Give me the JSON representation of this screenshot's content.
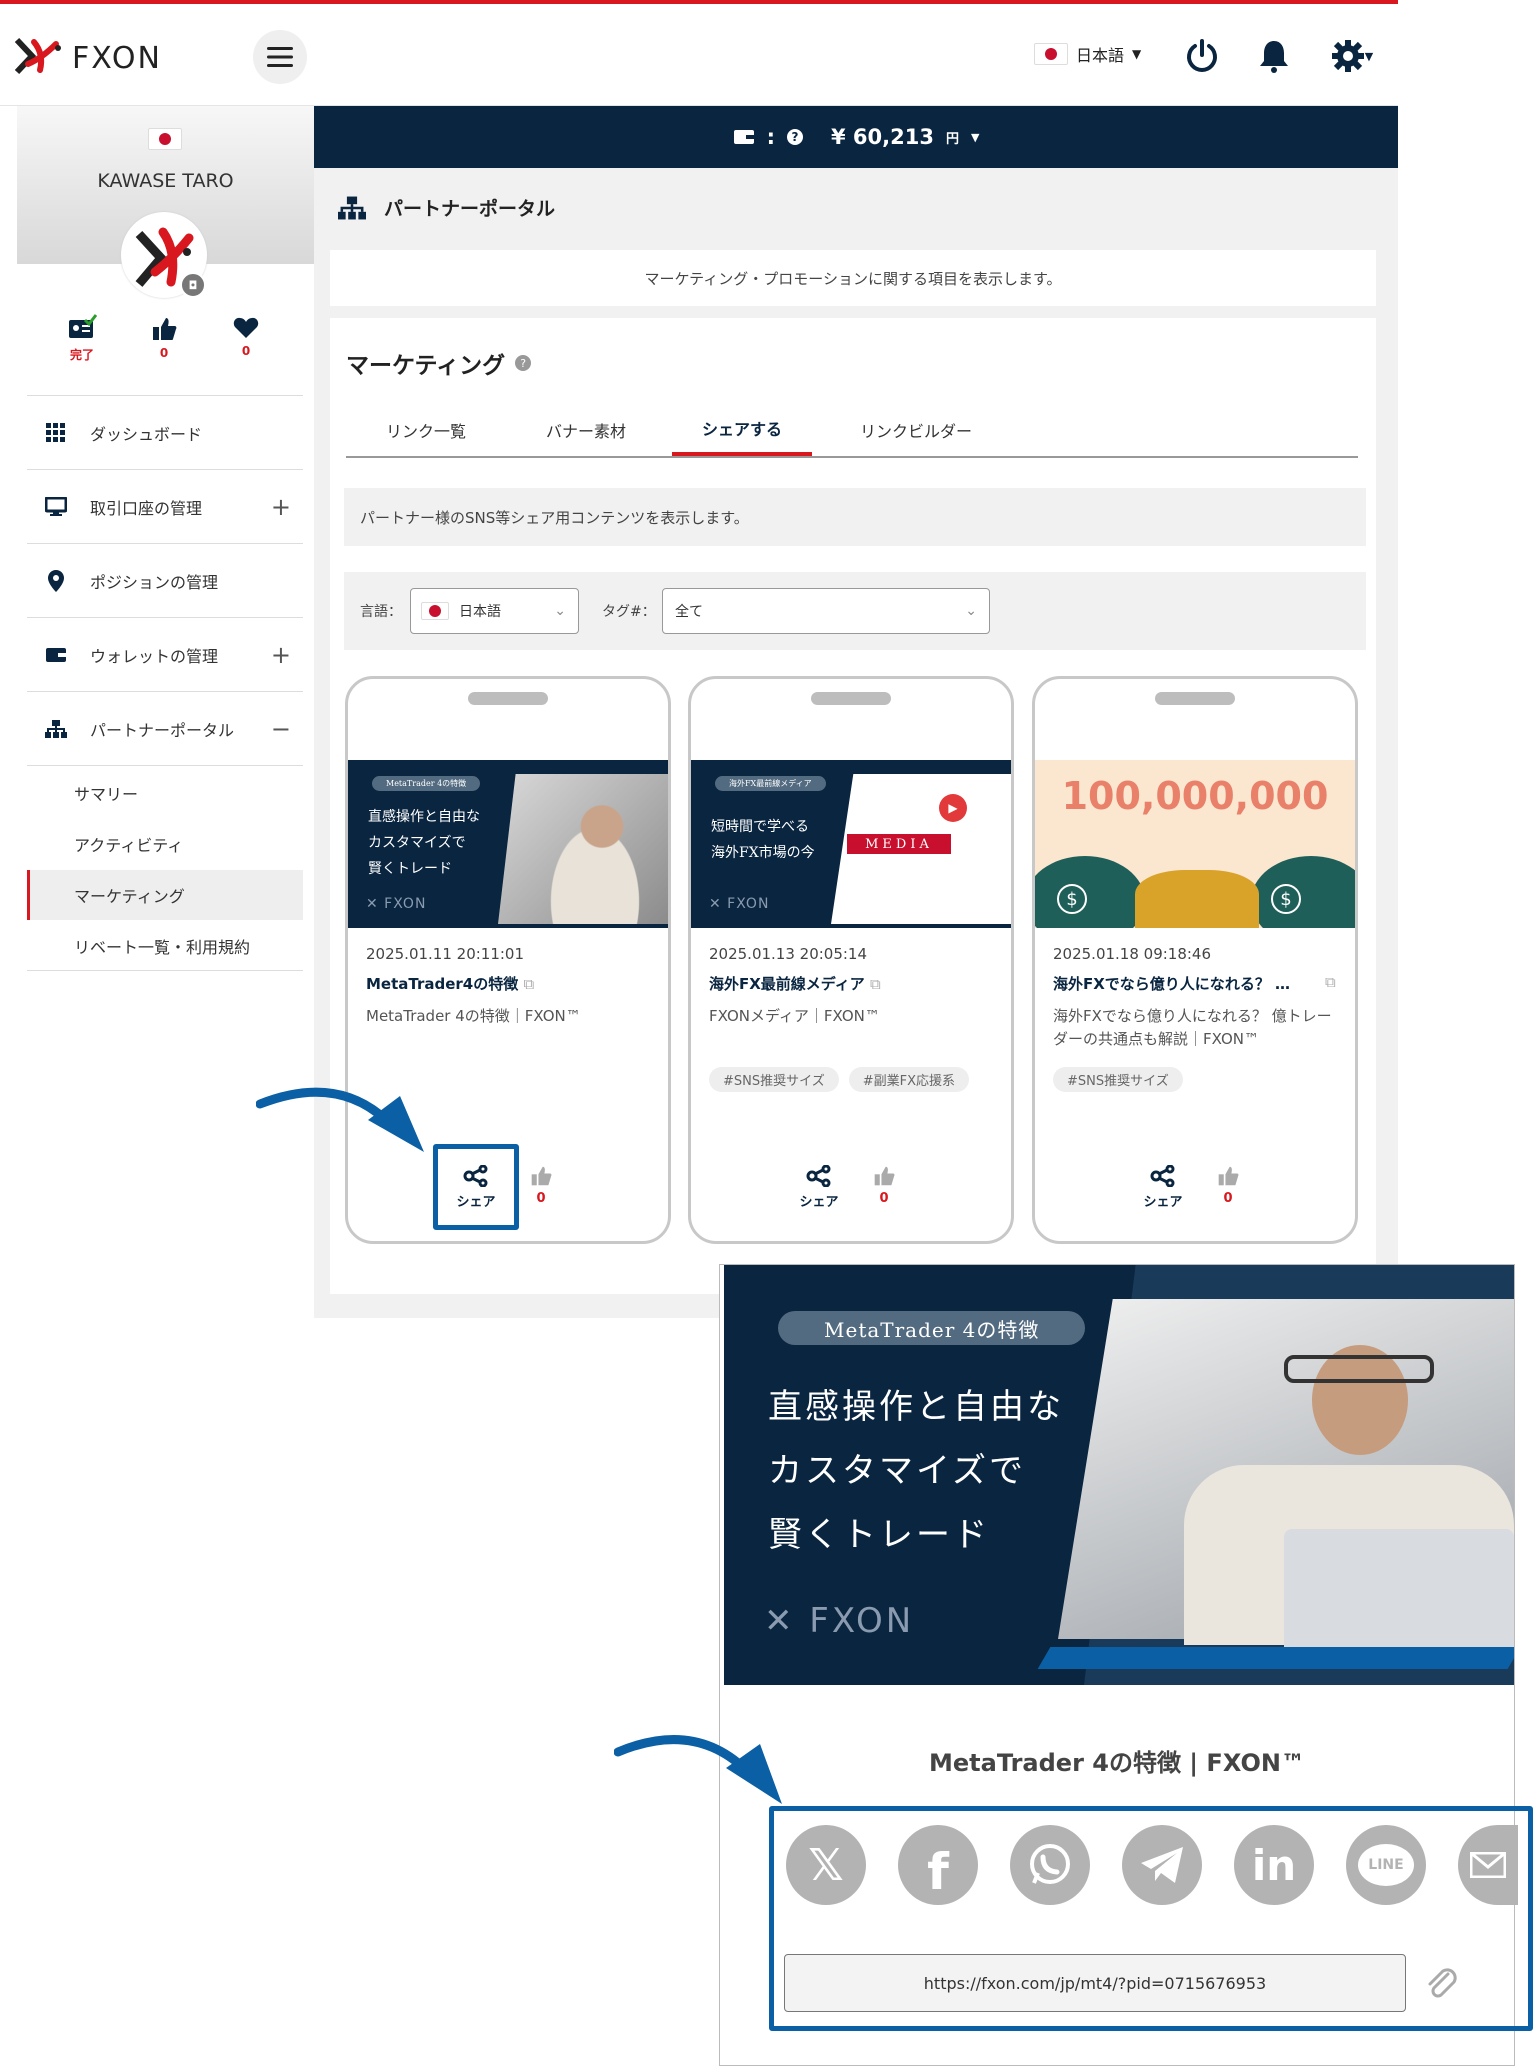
{
  "header": {
    "language": "日本語"
  },
  "profile": {
    "name": "KAWASE TARO",
    "stats": [
      {
        "label": "完了"
      },
      {
        "label": "0"
      },
      {
        "label": "0"
      }
    ]
  },
  "balance": {
    "sep": ":",
    "amount": "¥ 60,213",
    "currency": "円"
  },
  "sidebar": {
    "items": [
      {
        "label": "ダッシュボード",
        "icon": "grid-icon"
      },
      {
        "label": "取引口座の管理",
        "icon": "monitor-icon",
        "toggle": "+"
      },
      {
        "label": "ポジションの管理",
        "icon": "location-pin-icon"
      },
      {
        "label": "ウォレットの管理",
        "icon": "wallet-icon",
        "toggle": "+"
      },
      {
        "label": "パートナーポータル",
        "icon": "network-icon",
        "toggle": "−"
      }
    ],
    "subitems": [
      {
        "label": "サマリー"
      },
      {
        "label": "アクティビティ"
      },
      {
        "label": "マーケティング"
      },
      {
        "label": "リベート一覧・利用規約"
      }
    ]
  },
  "page": {
    "title": "パートナーポータル",
    "notice": "マーケティング・プロモーションに関する項目を表示します。",
    "section_title": "マーケティング",
    "tabs": [
      "リンク一覧",
      "バナー素材",
      "シェアする",
      "リンクビルダー"
    ],
    "info": "パートナー様のSNS等シェア用コンテンツを表示します。",
    "filter": {
      "lang_label": "言語：",
      "lang_value": "日本語",
      "tag_label": "タグ#：",
      "tag_value": "全て"
    }
  },
  "cards": [
    {
      "date": "2025.01.11 20:11:01",
      "title": "MetaTrader4の特徴",
      "desc": "MetaTrader 4の特徴｜FXON™",
      "tags": [],
      "share": "シェア",
      "likes": "0",
      "thumb": {
        "pill": "MetaTrader 4の特徴",
        "lines": [
          "直感操作と自由な",
          "カスタマイズで",
          "賢くトレード"
        ]
      }
    },
    {
      "date": "2025.01.13 20:05:14",
      "title": "海外FX最前線メディア",
      "desc": "FXONメディア｜FXON™",
      "tags": [
        "#SNS推奨サイズ",
        "#副業FX応援系"
      ],
      "share": "シェア",
      "likes": "0",
      "thumb": {
        "pill": "海外FX最前線メディア",
        "lines": [
          "短時間で学べる",
          "海外FX市場の今"
        ],
        "media": "MEDIA"
      }
    },
    {
      "date": "2025.01.18 09:18:46",
      "title": "海外FXでなら億り人になれる？ 億...",
      "desc": "海外FXでなら億り人になれる？ 億トレーダーの共通点も解説｜FXON™",
      "tags": [
        "#SNS推奨サイズ"
      ],
      "share": "シェア",
      "likes": "0",
      "thumb": {
        "big": "100,000,000"
      }
    }
  ],
  "share_panel": {
    "pill": "MetaTrader 4の特徴",
    "lines": [
      "直感操作と自由な",
      "カスタマイズで",
      "賢くトレード"
    ],
    "title": "MetaTrader 4の特徴 | FXON™",
    "networks": [
      "x-icon",
      "facebook-icon",
      "whatsapp-icon",
      "telegram-icon",
      "linkedin-icon",
      "line-icon",
      "email-icon"
    ],
    "url": "https://fxon.com/jp/mt4/?pid=0715676953"
  },
  "colors": {
    "navy": "#0a2540",
    "red": "#d8171e",
    "blue": "#0b5fa5",
    "grey": "#b3b3b3"
  }
}
